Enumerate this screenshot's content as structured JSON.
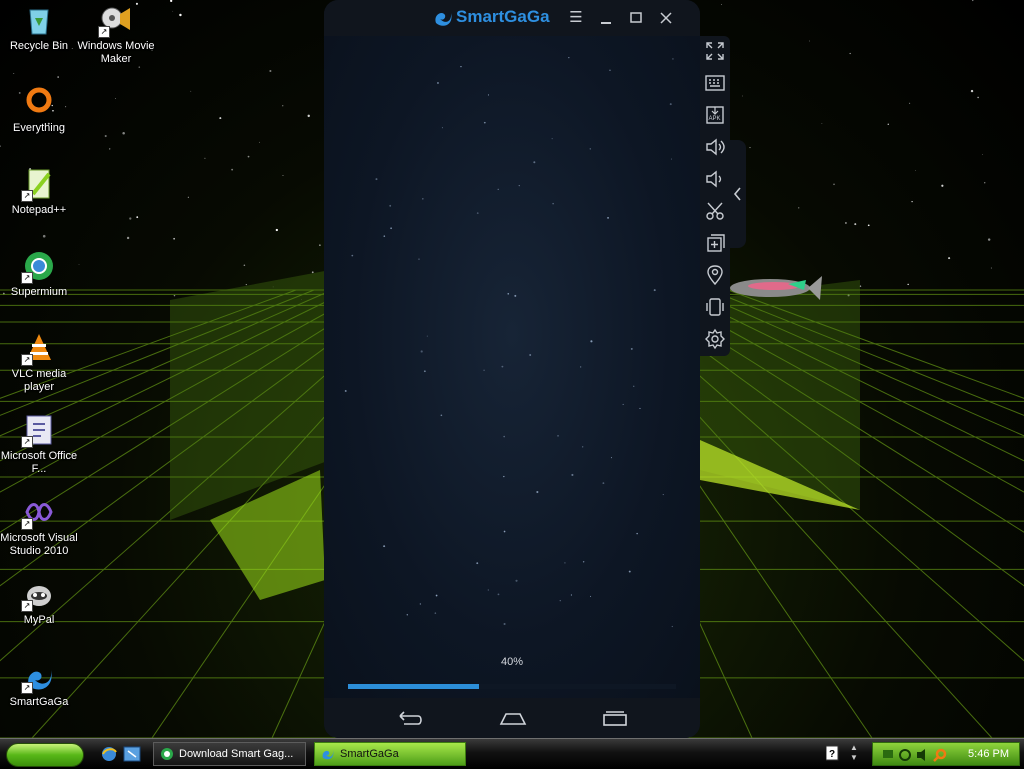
{
  "desktop": {
    "icons": [
      {
        "label": "Recycle Bin",
        "icon": "recycle-bin-icon"
      },
      {
        "label": "Windows Movie Maker",
        "icon": "movie-maker-icon"
      },
      {
        "label": "Everything",
        "icon": "everything-search-icon"
      },
      {
        "label": "Notepad++",
        "icon": "notepad-plus-plus-icon"
      },
      {
        "label": "Supermium",
        "icon": "supermium-browser-icon"
      },
      {
        "label": "VLC media player",
        "icon": "vlc-icon"
      },
      {
        "label": "Microsoft Office F...",
        "icon": "office-document-icon"
      },
      {
        "label": "Microsoft Visual Studio 2010",
        "icon": "visual-studio-icon"
      },
      {
        "label": "MyPal",
        "icon": "mypal-browser-icon"
      },
      {
        "label": "SmartGaGa",
        "icon": "smartgaga-icon"
      }
    ]
  },
  "emulator": {
    "title": "SmartGaGa",
    "loading_percent_text": "40%",
    "loading_progress": 0.4,
    "accent_color": "#2e8fe0",
    "titlebar_buttons": [
      "menu-icon",
      "minimize-icon",
      "maximize-icon",
      "close-icon"
    ],
    "sidebar_tools": [
      "fullscreen-icon",
      "keyboard-icon",
      "install-apk-icon",
      "volume-up-icon",
      "volume-down-icon",
      "screenshot-scissors-icon",
      "multi-instance-icon",
      "location-icon",
      "shake-icon",
      "settings-icon"
    ],
    "nav_buttons": [
      "back-icon",
      "home-icon",
      "recent-apps-icon"
    ]
  },
  "taskbar": {
    "tasks": [
      {
        "label": "Download Smart Gag..."
      },
      {
        "label": "SmartGaGa"
      }
    ],
    "clock": "5:46 PM"
  }
}
